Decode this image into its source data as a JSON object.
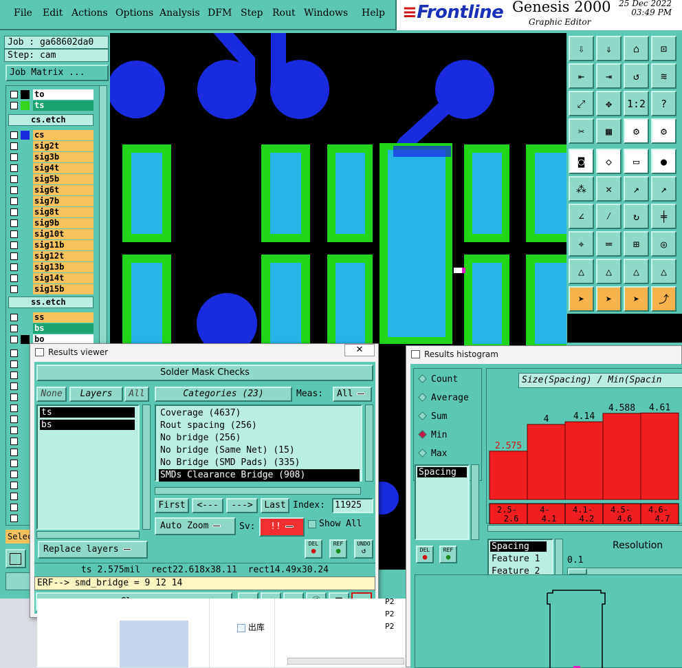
{
  "menu": [
    "File",
    "Edit",
    "Actions",
    "Options",
    "Analysis",
    "DFM",
    "Step",
    "Rout",
    "Windows",
    "Help"
  ],
  "brand": {
    "logo": "Frontline",
    "product": "Genesis 2000",
    "subtitle": "Graphic Editor",
    "date": "25 Dec 2022",
    "time": "03:49 PM"
  },
  "info": {
    "job": "Job : ga68602da0",
    "step": "Step: cam",
    "job_matrix": "Job Matrix ..."
  },
  "layers": {
    "top_group": [
      {
        "name": "to",
        "style": "white"
      },
      {
        "name": "ts",
        "style": "green"
      }
    ],
    "sep1": "cs.etch",
    "signal": [
      "cs",
      "sig2t",
      "sig3b",
      "sig4t",
      "sig5b",
      "sig6t",
      "sig7b",
      "sig8t",
      "sig9b",
      "sig10t",
      "sig11b",
      "sig12t",
      "sig13b",
      "sig14t",
      "sig15b"
    ],
    "sep2": "ss.etch",
    "bottom_group": [
      {
        "name": "ss",
        "style": "orange"
      },
      {
        "name": "bs",
        "style": "green"
      },
      {
        "name": "bo",
        "style": "white"
      }
    ],
    "select_label": "Selec"
  },
  "results_viewer": {
    "title": "Results viewer",
    "close_x": "✕",
    "header": "Solder Mask Checks",
    "none_btn": "None",
    "layers_btn": "Layers",
    "all_btn": "All",
    "categories_btn": "Categories (23)",
    "meas_label": "Meas:",
    "meas_value": "All",
    "layer_items": [
      "ts",
      "bs"
    ],
    "categories": [
      "Coverage (4637)",
      "Rout spacing (256)",
      "No bridge (256)",
      "No bridge (Same Net) (15)",
      "No Bridge (SMD Pads) (335)",
      "SMDs Clearance Bridge (908)"
    ],
    "selected_category": 5,
    "nav": {
      "first": "First",
      "prev": "<---",
      "next": "--->",
      "last": "Last"
    },
    "index_label": "Index:",
    "index_value": "11925",
    "auto_zoom": "Auto Zoom",
    "sv_label": "Sv:",
    "sv_value": "!!",
    "show_all": "Show All",
    "replace_layers": "Replace layers",
    "small_btns": [
      "DEL",
      "REF",
      "UNDO"
    ],
    "status": "ts 2.575mil  rect22.618x38.11  rect14.49x30.24",
    "erf": "ERF--> smd_bridge = 9 12 14",
    "close": "Close"
  },
  "histogram": {
    "title": "Results histogram",
    "modes": [
      "Count",
      "Average",
      "Sum",
      "Min",
      "Max"
    ],
    "selected_mode": "Min",
    "chart_title": "Size(Spacing) / Min(Spacin",
    "list_item": "Spacing",
    "small_btns": [
      "DEL",
      "REF"
    ],
    "field_items": [
      "Spacing",
      "Feature 1",
      "Feature 2"
    ],
    "resolution_label": "Resolution",
    "resolution_value": "0.1"
  },
  "chart_data": {
    "type": "bar",
    "title": "Size(Spacing) / Min(Spacin",
    "categories": [
      "2.5-2.6",
      "4-4.1",
      "4.1-4.2",
      "4.5-4.6",
      "4.6-4.7"
    ],
    "category_lines": [
      [
        "2.5-",
        "2.6"
      ],
      [
        "4-",
        "4.1"
      ],
      [
        "4.1-",
        "4.2"
      ],
      [
        "4.5-",
        "4.6"
      ],
      [
        "4.6-",
        "4.7"
      ]
    ],
    "values": [
      2.575,
      4,
      4.14,
      4.588,
      4.61
    ],
    "value_labels": [
      "2.575",
      "4",
      "4.14",
      "4.588",
      "4.61"
    ],
    "ylim": [
      0,
      5.5
    ],
    "colors": {
      "bar": "#f01e1e",
      "first_label": "#d01010"
    }
  },
  "explorer": {
    "folder": "出库",
    "col": [
      "P2",
      "P2",
      "P2"
    ]
  }
}
